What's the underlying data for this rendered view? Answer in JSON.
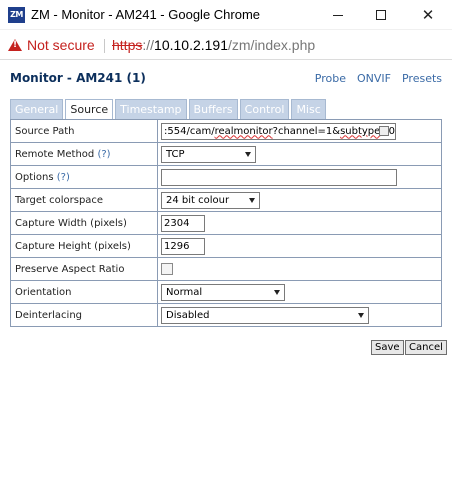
{
  "window": {
    "app_icon_text": "ZM",
    "title": "ZM - Monitor - AM241 - Google Chrome",
    "close_glyph": "✕"
  },
  "addressbar": {
    "security_label": "Not secure",
    "scheme": "https",
    "separator": "://",
    "host": "10.10.2.191",
    "path": "/zm/index.php"
  },
  "header": {
    "title": "Monitor - AM241 (1)",
    "links": [
      "Probe",
      "ONVIF",
      "Presets"
    ]
  },
  "tabs": [
    "General",
    "Source",
    "Timestamp",
    "Buffers",
    "Control",
    "Misc"
  ],
  "active_tab": "Source",
  "fields": {
    "source_path": {
      "label": "Source Path",
      "value_prefix": ":554/cam/",
      "value_word1": "realmonitor",
      "value_mid": "?channel=1&",
      "value_word2": "subtype",
      "value_suffix": "=0"
    },
    "remote_method": {
      "label": "Remote Method",
      "help": "(?)",
      "value": "TCP"
    },
    "options": {
      "label": "Options",
      "help": "(?)",
      "value": ""
    },
    "target_colorspace": {
      "label": "Target colorspace",
      "value": "24 bit colour"
    },
    "capture_width": {
      "label": "Capture Width (pixels)",
      "value": "2304"
    },
    "capture_height": {
      "label": "Capture Height (pixels)",
      "value": "1296"
    },
    "preserve_aspect": {
      "label": "Preserve Aspect Ratio",
      "checked": false
    },
    "orientation": {
      "label": "Orientation",
      "value": "Normal"
    },
    "deinterlacing": {
      "label": "Deinterlacing",
      "value": "Disabled"
    }
  },
  "buttons": {
    "save": "Save",
    "cancel": "Cancel"
  },
  "colors": {
    "title_text": "#0c2f5c",
    "link": "#3a6aa6",
    "tab_inactive": "#c5d3e6",
    "table_border": "#8a9bb4",
    "insecure_red": "#c5221f"
  }
}
